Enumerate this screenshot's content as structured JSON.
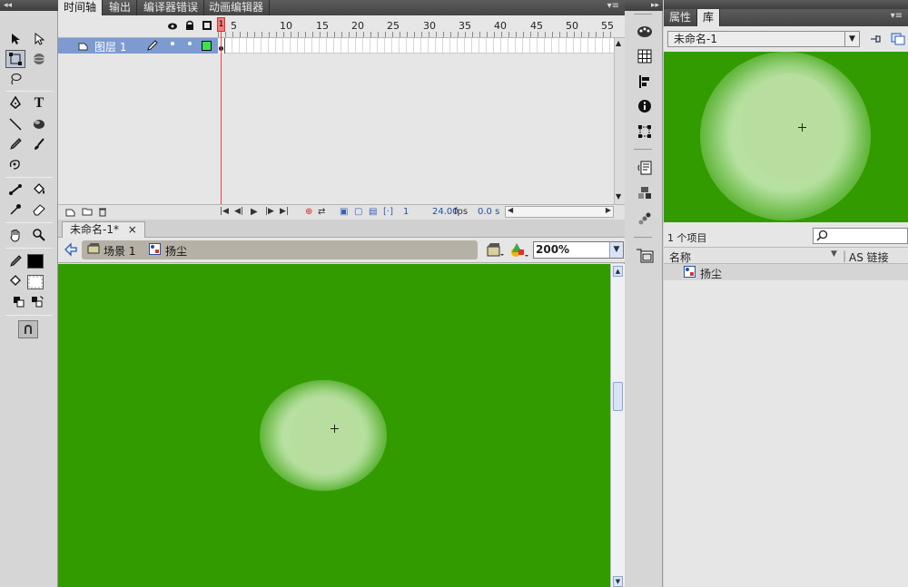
{
  "timeline": {
    "tabs": [
      "时间轴",
      "输出",
      "编译器错误",
      "动画编辑器"
    ],
    "layer_name": "图层 1",
    "frame_numbers": [
      "5",
      "10",
      "15",
      "20",
      "25",
      "30",
      "35",
      "40",
      "45",
      "50",
      "55"
    ],
    "current_frame": "1",
    "fps": "24.00",
    "fps_unit": "fps",
    "time": "0.0 s"
  },
  "document": {
    "tab_title": "未命名-1*",
    "tab_close": "×",
    "scene": "场景 1",
    "symbol": "扬尘",
    "zoom": "200%"
  },
  "library": {
    "tabs": [
      "属性",
      "库"
    ],
    "document_name": "未命名-1",
    "item_count": "1 个项目",
    "col_name": "名称",
    "col_linkage": "AS 链接",
    "items": [
      {
        "name": "扬尘"
      }
    ]
  },
  "colors": {
    "stage": "#319b00",
    "puff_core": "#b3db9a",
    "layer_selected": "#7d9bd0"
  },
  "icons": {
    "tools": [
      "selection-icon",
      "subselection-icon",
      "free-transform-icon",
      "3d-rotation-icon",
      "lasso-icon",
      "pen-icon",
      "text-icon",
      "line-icon",
      "oval-icon",
      "pencil-icon",
      "brush-icon",
      "deco-icon",
      "bone-icon",
      "paint-bucket-icon",
      "eyedropper-icon",
      "eraser-icon",
      "hand-icon",
      "zoom-icon"
    ]
  }
}
